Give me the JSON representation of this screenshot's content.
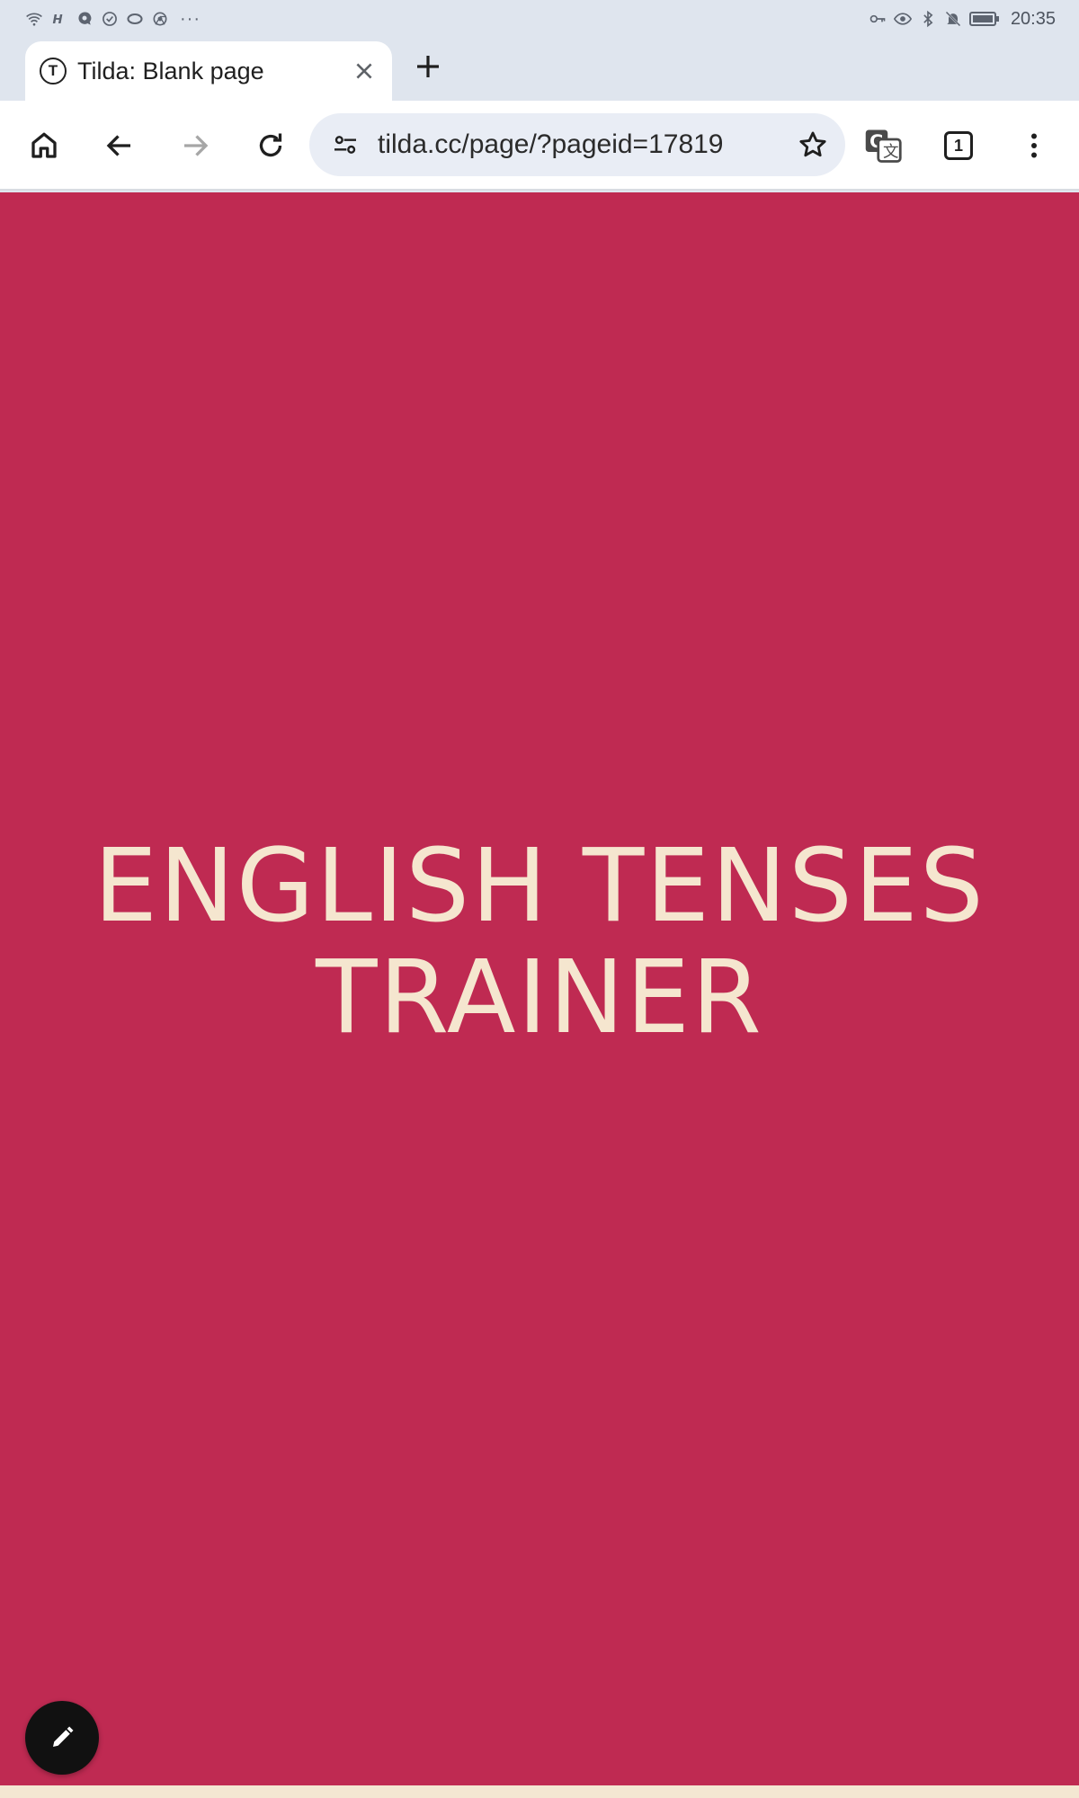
{
  "status_bar": {
    "time": "20:35",
    "overflow_indicator": "···"
  },
  "tab": {
    "title": "Tilda: Blank page",
    "favicon_letter": "T"
  },
  "omnibox": {
    "url": "tilda.cc/page/?pageid=17819"
  },
  "toolbar": {
    "tab_count": "1"
  },
  "hero": {
    "title_line1": "ENGLISH TENSES",
    "title_line2": "TRAINER",
    "background_color": "#bf2a52",
    "text_color": "#f5e6cf"
  }
}
